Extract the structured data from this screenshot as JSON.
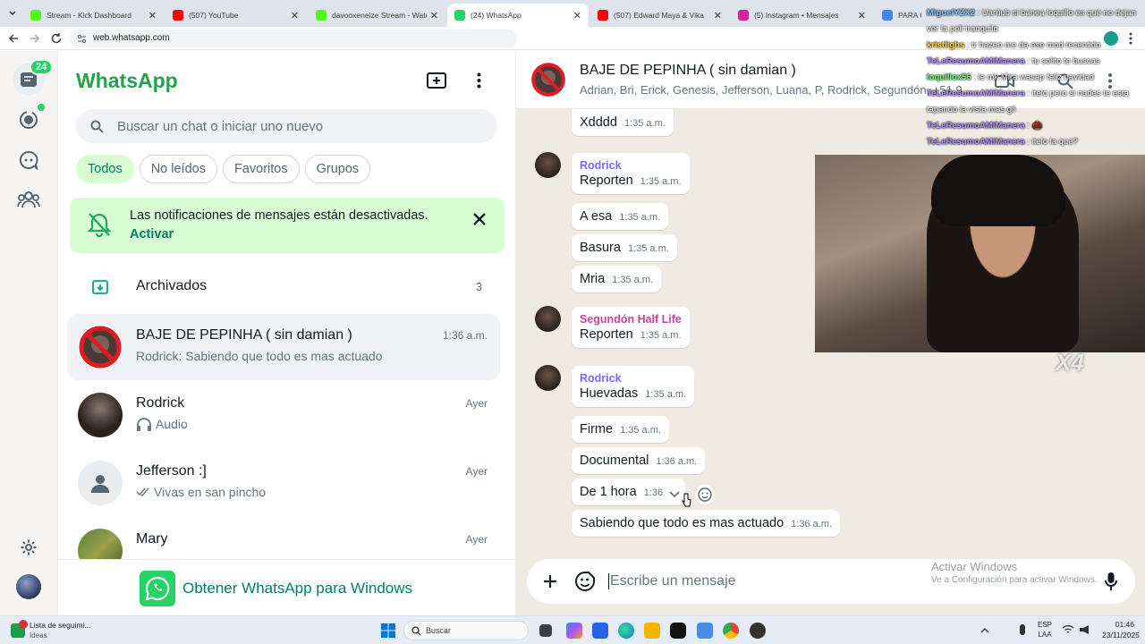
{
  "browser": {
    "tabs": [
      {
        "label": "Stream - Kick Dashboard",
        "color": "#53fc18"
      },
      {
        "label": "(507) YouTube",
        "color": "#ff0000"
      },
      {
        "label": "davooxeneize Stream - Watch L",
        "color": "#53fc18"
      },
      {
        "label": "(24) WhatsApp",
        "color": "#25d366"
      },
      {
        "label": "(507) Edward Maya & Vika",
        "color": "#ff0000"
      },
      {
        "label": "(5) Instagram • Mensajes",
        "color": "#d6249f"
      },
      {
        "label": "PARA Q SE",
        "color": "#4285f4"
      }
    ],
    "url": "web.whatsapp.com"
  },
  "rail": {
    "badge": "24"
  },
  "list": {
    "title": "WhatsApp",
    "search_placeholder": "Buscar un chat o iniciar uno nuevo",
    "filters": [
      "Todos",
      "No leídos",
      "Favoritos",
      "Grupos"
    ],
    "notice": {
      "text": "Las notificaciones de mensajes están desactivadas.",
      "action": "Activar"
    },
    "archived": {
      "label": "Archivados",
      "count": "3"
    },
    "chats": [
      {
        "name": "BAJE DE PEPINHA ( sin damian )",
        "time": "1:36 a.m.",
        "preview": "Rodrick: Sabiendo que todo es mas actuado"
      },
      {
        "name": "Rodrick",
        "time": "Ayer",
        "preview": "Audio"
      },
      {
        "name": "Jefferson :]",
        "time": "Ayer",
        "preview": "Vivas en san pincho"
      },
      {
        "name": "Mary",
        "time": "Ayer",
        "preview": ""
      }
    ],
    "promo": "Obtener WhatsApp para Windows"
  },
  "convo": {
    "title": "BAJE DE PEPINHA ( sin damian )",
    "members": "Adrian, Bri, Erick, Genesis, Jefferson, Luana, P, Rodrick, Segundón, +51 9",
    "messages": [
      {
        "text": "Xdddd",
        "time": "1:35 a.m."
      },
      {
        "sender": "Rodrick",
        "text": "Reporten",
        "time": "1:35 a.m."
      },
      {
        "text": "A esa",
        "time": "1:35 a.m."
      },
      {
        "text": "Basura",
        "time": "1:35 a.m."
      },
      {
        "text": "Mria",
        "time": "1:35 a.m."
      },
      {
        "sender": "Segundón Half Life",
        "text": "Reporten",
        "time": "1:35 a.m."
      },
      {
        "sender": "Rodrick",
        "text": "Huevadas",
        "time": "1:35 a.m."
      },
      {
        "text": "Firme",
        "time": "1:35 a.m."
      },
      {
        "text": "Documental",
        "time": "1:36 a.m."
      },
      {
        "text": "De 1 hora",
        "time": "1:36"
      },
      {
        "text": "Sabiendo que todo es mas actuado",
        "time": "1:36 a.m."
      }
    ],
    "sender_colors": {
      "Rodrick": "#7f66ff",
      "Segundón Half Life": "#c4469d"
    },
    "composer_placeholder": "Escribe un mensaje"
  },
  "watermark": {
    "line1": "Activar Windows",
    "line2": "Ve a Configuración para activar Windows."
  },
  "stream_overlay": {
    "multiplier": "X4",
    "chat": [
      {
        "user": "MiguelYZX2",
        "color": "#7ec8ff",
        "text": "Uarüub si banea loquillo es que no dejan ver la peli tranquilo"
      },
      {
        "user": "kristiighs",
        "color": "#ffd24a",
        "text": "tr hazeo me da ese mod recentido"
      },
      {
        "user": "TeLeResumoAMiManera",
        "color": "#b794ff",
        "text": "tu solito te buscas"
      },
      {
        "user": "loquillox56",
        "color": "#73ff73",
        "text": "le mk Mira wasap feliz navidad"
      },
      {
        "user": "TeLeResumoAMiManera",
        "color": "#b794ff",
        "text": "itelo pero si nades te esta tapando la vista mas gil"
      },
      {
        "user": "TeLeResumoAMiManera",
        "color": "#b794ff",
        "text": "🌰"
      },
      {
        "user": "TeLeResumoAMiManera",
        "color": "#b794ff",
        "text": "itelo la que?"
      }
    ]
  },
  "taskbar": {
    "widget_title": "Lista de seguimi...",
    "widget_sub": "Ideas",
    "search": "Buscar",
    "lang1": "ESP",
    "lang2": "LAA",
    "time": "01:46",
    "date": "23/11/2025"
  }
}
